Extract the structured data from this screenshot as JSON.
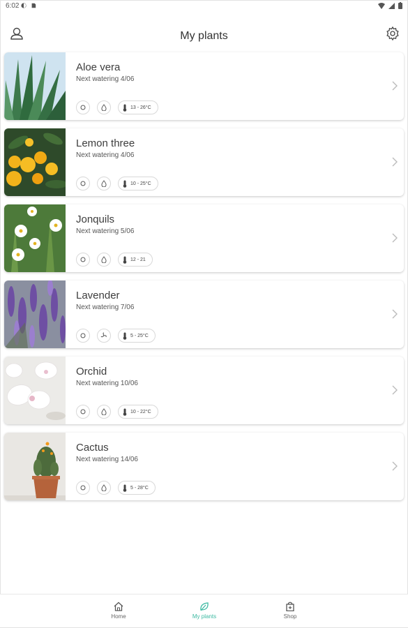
{
  "status_bar": {
    "time": "6:02"
  },
  "header": {
    "title": "My plants"
  },
  "plants": [
    {
      "name": "Aloe vera",
      "next": "Next watering 4/06",
      "temp": "13 - 26°C",
      "second_icon": "water-drop-icon"
    },
    {
      "name": "Lemon three",
      "next": "Next watering 4/06",
      "temp": "10 - 25°C",
      "second_icon": "water-drop-icon"
    },
    {
      "name": "Jonquils",
      "next": "Next watering 5/06",
      "temp": "12 - 21",
      "second_icon": "water-drop-icon"
    },
    {
      "name": "Lavender",
      "next": "Next watering 7/06",
      "temp": "5 - 25°C",
      "second_icon": "fan-icon"
    },
    {
      "name": "Orchid",
      "next": "Next watering 10/06",
      "temp": "10 - 22°C",
      "second_icon": "water-drop-icon"
    },
    {
      "name": "Cactus",
      "next": "Next watering 14/06",
      "temp": "5 - 28°C",
      "second_icon": "water-drop-icon"
    }
  ],
  "bottom_nav": {
    "home": "Home",
    "my_plants": "My plants",
    "shop": "Shop"
  },
  "colors": {
    "accent": "#3bb9a1"
  }
}
